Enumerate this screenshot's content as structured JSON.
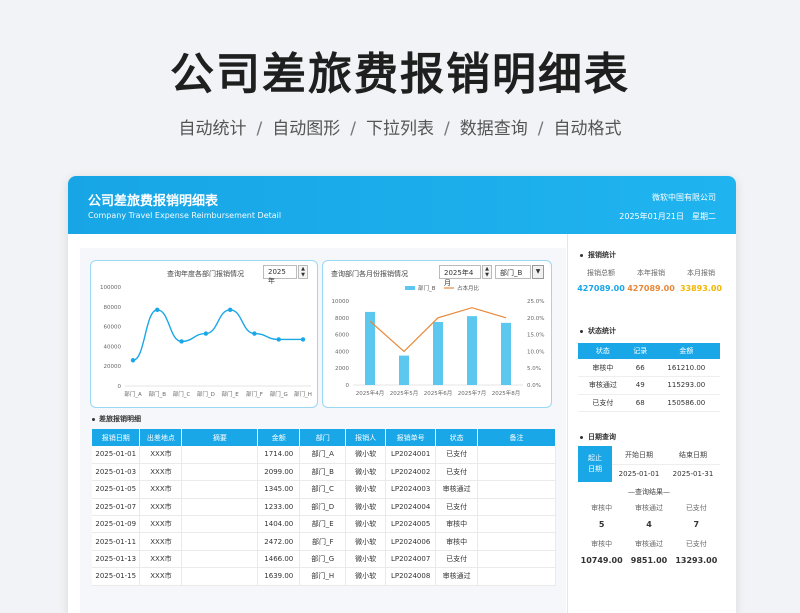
{
  "hero": {
    "title": "公司差旅费报销明细表",
    "features": [
      "自动统计",
      "自动图形",
      "下拉列表",
      "数据查询",
      "自动格式"
    ],
    "separator": "/"
  },
  "banner": {
    "title": "公司差旅费报销明细表",
    "subtitle": "Company Travel Expense Reimbursement Detail",
    "company": "微软中国有限公司",
    "date": "2025年01月21日",
    "weekday": "星期二"
  },
  "chart1_ui": {
    "title": "查询年度各部门报销情况",
    "year": "2025 年"
  },
  "chart2_ui": {
    "title": "查询部门各月份报销情况",
    "month": "2025年4月",
    "dept": "部门_B",
    "legend_bar": "部门_B",
    "legend_line": "占本月比"
  },
  "chart_data": [
    {
      "type": "line",
      "title": "查询年度各部门报销情况",
      "categories": [
        "部门_A",
        "部门_B",
        "部门_C",
        "部门_D",
        "部门_E",
        "部门_F",
        "部门_G",
        "部门_H"
      ],
      "values": [
        26000,
        77000,
        45000,
        53000,
        77000,
        53000,
        47000,
        47000
      ],
      "ylim": [
        0,
        100000
      ],
      "yticks": [
        "0",
        "20000",
        "40000",
        "60000",
        "80000",
        "100000"
      ],
      "grid": false,
      "colors": {
        "line": "#1aa7e8"
      }
    },
    {
      "type": "bar",
      "title": "查询部门各月份报销情况",
      "categories": [
        "2025年4月",
        "2025年5月",
        "2025年6月",
        "2025年7月",
        "2025年8月"
      ],
      "series": [
        {
          "name": "部门_B",
          "type": "bar",
          "axis": "left",
          "values": [
            8700,
            3500,
            7500,
            8200,
            7400
          ]
        },
        {
          "name": "占本月比",
          "type": "line",
          "axis": "right",
          "values": [
            0.19,
            0.1,
            0.2,
            0.23,
            0.2
          ]
        }
      ],
      "ylim_left": [
        0,
        10000
      ],
      "yticks_left": [
        "0",
        "2000",
        "4000",
        "6000",
        "8000",
        "10000"
      ],
      "ylim_right": [
        0,
        0.25
      ],
      "yticks_right": [
        "0.0%",
        "5.0%",
        "10.0%",
        "15.0%",
        "20.0%",
        "25.0%"
      ],
      "legend": "top",
      "colors": {
        "bar": "#5cc8ef",
        "line": "#e8883a"
      }
    }
  ],
  "detail": {
    "section_title": "差旅报销明细",
    "headers": [
      "报销日期",
      "出差地点",
      "摘要",
      "金额",
      "部门",
      "报销人",
      "报销单号",
      "状态",
      "备注"
    ],
    "rows": [
      [
        "2025-01-01",
        "XXX市",
        "",
        "1714.00",
        "部门_A",
        "微小软",
        "LP2024001",
        "已支付",
        ""
      ],
      [
        "2025-01-03",
        "XXX市",
        "",
        "2099.00",
        "部门_B",
        "微小软",
        "LP2024002",
        "已支付",
        ""
      ],
      [
        "2025-01-05",
        "XXX市",
        "",
        "1345.00",
        "部门_C",
        "微小软",
        "LP2024003",
        "审核通过",
        ""
      ],
      [
        "2025-01-07",
        "XXX市",
        "",
        "1233.00",
        "部门_D",
        "微小软",
        "LP2024004",
        "已支付",
        ""
      ],
      [
        "2025-01-09",
        "XXX市",
        "",
        "1404.00",
        "部门_E",
        "微小软",
        "LP2024005",
        "审核中",
        ""
      ],
      [
        "2025-01-11",
        "XXX市",
        "",
        "2472.00",
        "部门_F",
        "微小软",
        "LP2024006",
        "审核中",
        ""
      ],
      [
        "2025-01-13",
        "XXX市",
        "",
        "1466.00",
        "部门_G",
        "微小软",
        "LP2024007",
        "已支付",
        ""
      ],
      [
        "2025-01-15",
        "XXX市",
        "",
        "1639.00",
        "部门_H",
        "微小软",
        "LP2024008",
        "审核通过",
        ""
      ]
    ]
  },
  "stats": {
    "title": "报销统计",
    "labels": [
      "报销总额",
      "本年报销",
      "本月报销"
    ],
    "values": [
      "427089.00",
      "427089.00",
      "33893.00"
    ],
    "colors": [
      "#1aa7e8",
      "#e8883a",
      "#f2b705"
    ]
  },
  "status_stats": {
    "title": "状态统计",
    "headers": [
      "状态",
      "记录",
      "金额"
    ],
    "rows": [
      [
        "审核中",
        "66",
        "161210.00"
      ],
      [
        "审核通过",
        "49",
        "115293.00"
      ],
      [
        "已支付",
        "68",
        "150586.00"
      ]
    ]
  },
  "date_query": {
    "title": "日期查询",
    "label_line1": "起止",
    "label_line2": "日期",
    "start_label": "开始日期",
    "end_label": "结束日期",
    "start": "2025-01-01",
    "end": "2025-01-31",
    "result_title": "—查询结果—",
    "result_labels": [
      "审核中",
      "审核通过",
      "已支付"
    ],
    "result_counts": [
      "5",
      "4",
      "7"
    ],
    "amount_labels": [
      "审核中",
      "审核通过",
      "已支付"
    ],
    "amounts": [
      "10749.00",
      "9851.00",
      "13293.00"
    ]
  }
}
